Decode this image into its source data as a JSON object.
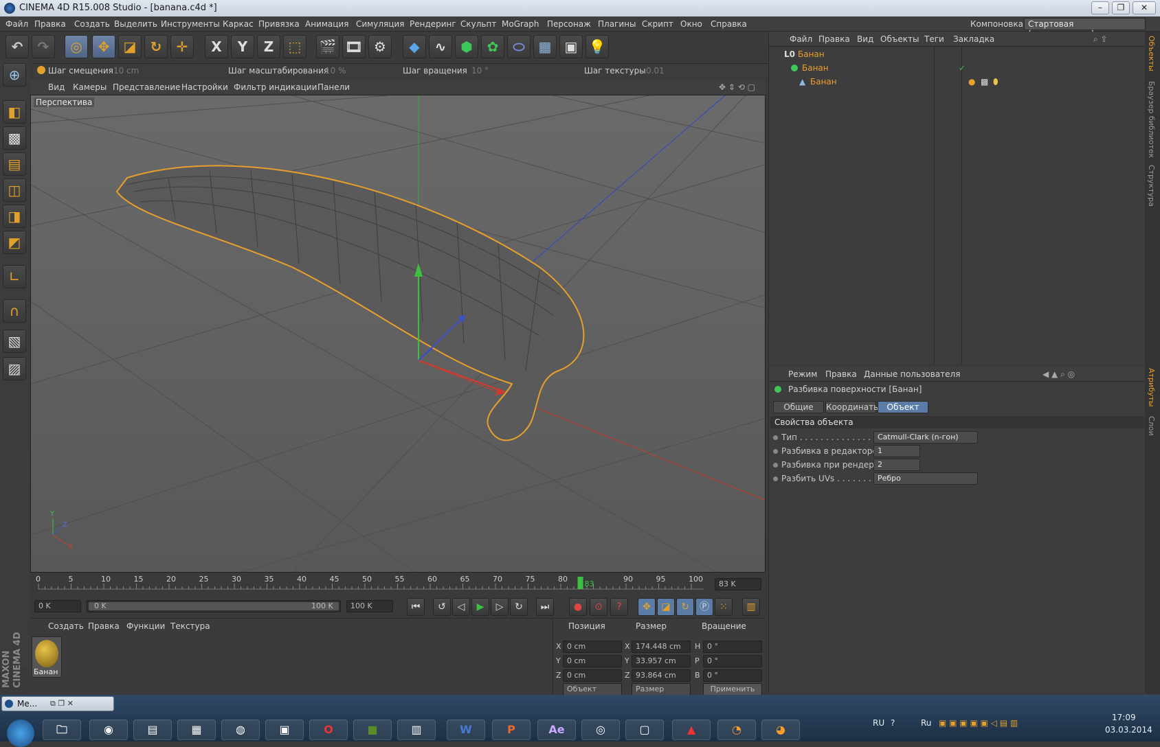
{
  "window": {
    "title": "CINEMA 4D R15.008 Studio - [banana.c4d *]"
  },
  "menu": {
    "items": [
      "Файл",
      "Правка",
      "Создать",
      "Выделить",
      "Инструменты",
      "Каркас",
      "Привязка",
      "Анимация",
      "Симуляция",
      "Рендеринг",
      "Скульпт",
      "MoGraph",
      "Персонаж",
      "Плагины",
      "Скрипт",
      "Окно",
      "Справка"
    ],
    "layout_label": "Компоновка",
    "layout_value": "Стартовая (пользователь)"
  },
  "toolbar": {
    "axis_x": "X",
    "axis_y": "Y",
    "axis_z": "Z"
  },
  "steps": {
    "move_label": "Шаг смещения",
    "move_value": "10 cm",
    "scale_label": "Шаг масштабирования",
    "scale_value": "10 %",
    "rotate_label": "Шаг вращения",
    "rotate_value": "10 °",
    "texture_label": "Шаг текстуры",
    "texture_value": "0.01"
  },
  "viewport": {
    "menu": [
      "Вид",
      "Камеры",
      "Представление",
      "Настройки",
      "Фильтр индикации",
      "Панели"
    ],
    "label": "Перспектива",
    "axis_y": "Y",
    "axis_z": "Z",
    "axis_x": "X"
  },
  "timeline": {
    "ticks": [
      "0",
      "5",
      "10",
      "15",
      "20",
      "25",
      "30",
      "35",
      "40",
      "45",
      "50",
      "55",
      "60",
      "65",
      "70",
      "75",
      "80",
      "85",
      "90",
      "95",
      "100"
    ],
    "current_label": "83",
    "current_frame": 83,
    "frame_field": "83 K"
  },
  "transport": {
    "start": "0 K",
    "range_start": "0 K",
    "range_end": "100 K",
    "end": "100 K"
  },
  "material_manager": {
    "menu": [
      "Создать",
      "Правка",
      "Функции",
      "Текстура"
    ],
    "material_name": "Банан"
  },
  "coords": {
    "headers": [
      "Позиция",
      "Размер",
      "Вращение"
    ],
    "rows": [
      {
        "axis": "X",
        "pos": "0 cm",
        "size_axis": "X",
        "size": "174.448 cm",
        "rot_axis": "H",
        "rot": "0 °"
      },
      {
        "axis": "Y",
        "pos": "0 cm",
        "size_axis": "Y",
        "size": "33.957 cm",
        "rot_axis": "P",
        "rot": "0 °"
      },
      {
        "axis": "Z",
        "pos": "0 cm",
        "size_axis": "Z",
        "size": "93.864 cm",
        "rot_axis": "B",
        "rot": "0 °"
      }
    ],
    "mode": "Объект",
    "size_mode": "Размер",
    "apply": "Применить"
  },
  "object_manager": {
    "menu": [
      "Файл",
      "Правка",
      "Вид",
      "Объекты",
      "Теги",
      "Закладка"
    ],
    "rows": [
      {
        "prefix": "L0",
        "name": "Банан"
      },
      {
        "name": "Банан"
      },
      {
        "name": "Банан"
      }
    ]
  },
  "attributes": {
    "menu": [
      "Режим",
      "Правка",
      "Данные пользователя"
    ],
    "title": "Разбивка поверхности [Банан]",
    "tabs": [
      "Общие",
      "Координаты",
      "Объект"
    ],
    "section": "Свойства объекта",
    "props": [
      {
        "label": "Тип . . . . . . . . . . . . . . .",
        "value": "Catmull-Clark (n-гон)"
      },
      {
        "label": "Разбивка в редакторе",
        "value": "1"
      },
      {
        "label": "Разбивка при рендере",
        "value": "2"
      },
      {
        "label": "Разбить UVs . . . . . . . . .",
        "value": "Ребро"
      }
    ]
  },
  "side_tabs": [
    "Объекты",
    "Браузер библиотек",
    "Структура",
    "Атрибуты",
    "Слои"
  ],
  "brand": {
    "line1": "MAXON",
    "line2": "CINEMA 4D"
  },
  "minimized": {
    "label": "Me..."
  },
  "taskbar": {
    "apps": [
      "Ae",
      "W",
      "P"
    ],
    "lang": "RU",
    "lang2": "Ru",
    "time": "17:09",
    "date": "03.03.2014"
  },
  "colors": {
    "accent": "#e8a02c",
    "selection": "#5b7ca6",
    "axis_x": "#d23b2f",
    "axis_y": "#3fbf3f",
    "axis_z": "#3b50c8"
  }
}
